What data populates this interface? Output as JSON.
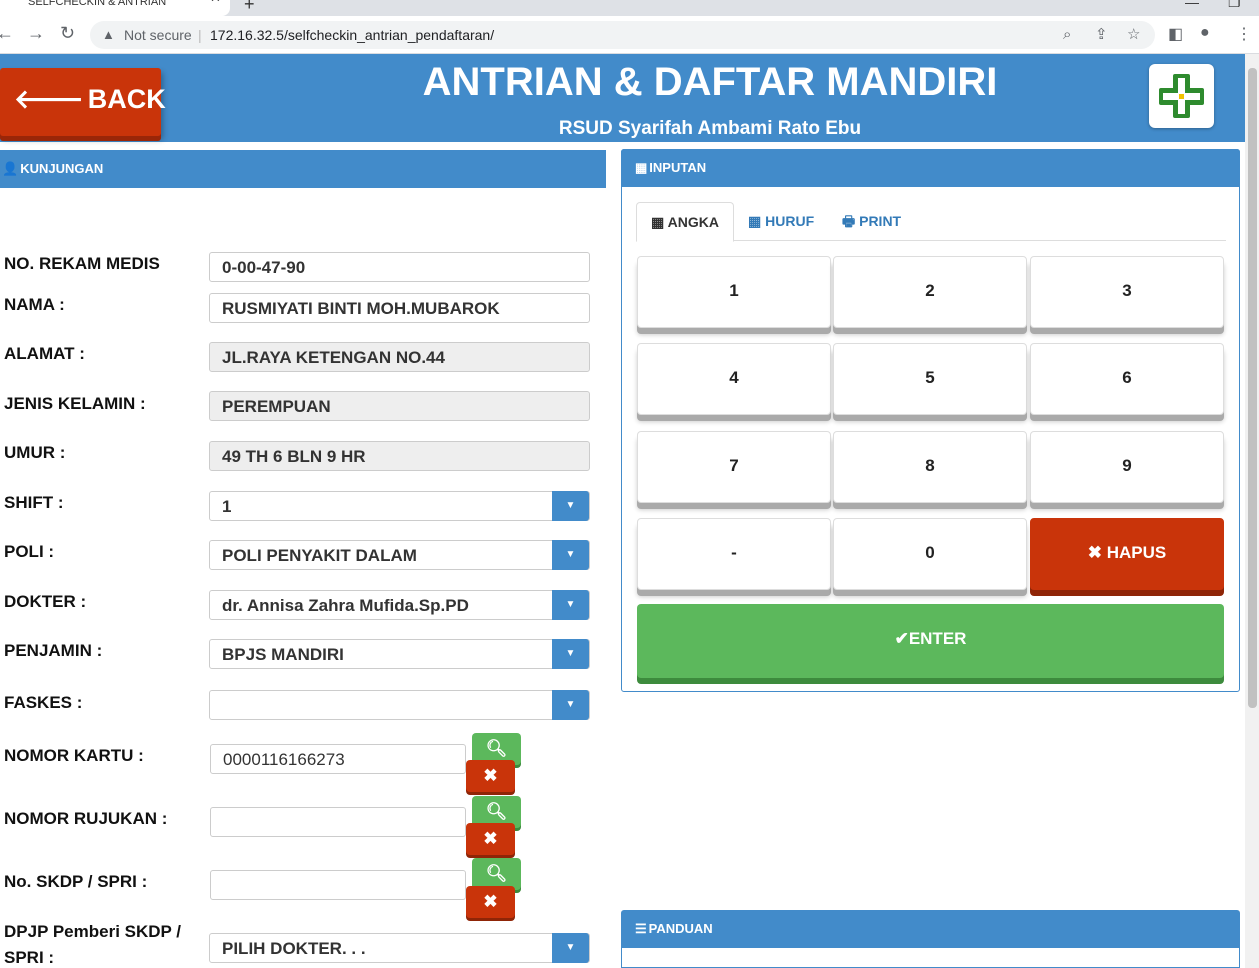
{
  "browser": {
    "tab_title": "SELFCHECKIN & ANTRIAN",
    "not_secure": "Not secure",
    "url": "172.16.32.5/selfcheckin_antrian_pendaftaran/"
  },
  "header": {
    "back_label": "BACK",
    "title": "ANTRIAN & DAFTAR MANDIRI",
    "subtitle": "RSUD Syarifah Ambami Rato Ebu"
  },
  "kunjungan": {
    "heading": "KUNJUNGAN",
    "fields": {
      "no_rm_label": "NO. REKAM MEDIS",
      "no_rm_value": "0-00-47-90",
      "nama_label": "NAMA :",
      "nama_value": "RUSMIYATI BINTI MOH.MUBAROK",
      "alamat_label": "ALAMAT :",
      "alamat_value": "JL.RAYA KETENGAN NO.44",
      "jk_label": "JENIS KELAMIN :",
      "jk_value": "PEREMPUAN",
      "umur_label": "UMUR :",
      "umur_value": "49 TH 6 BLN 9 HR",
      "shift_label": "SHIFT :",
      "shift_value": "1",
      "poli_label": "POLI :",
      "poli_value": "POLI PENYAKIT DALAM",
      "dokter_label": "DOKTER :",
      "dokter_value": "dr. Annisa Zahra Mufida.Sp.PD",
      "penjamin_label": "PENJAMIN :",
      "penjamin_value": "BPJS MANDIRI",
      "faskes_label": "FASKES :",
      "faskes_value": "",
      "kartu_label": "NOMOR KARTU :",
      "kartu_value": "0000116166273",
      "rujukan_label": "NOMOR RUJUKAN :",
      "rujukan_value": "",
      "skdp_label": "No. SKDP / SPRI :",
      "skdp_value": "",
      "dpjp_label_1": "DPJP Pemberi SKDP /",
      "dpjp_label_2": "SPRI :",
      "dpjp_value": "PILIH DOKTER. . ."
    }
  },
  "inputan": {
    "heading": "INPUTAN",
    "tabs": [
      "ANGKA",
      "HURUF",
      "PRINT"
    ],
    "keys": [
      "1",
      "2",
      "3",
      "4",
      "5",
      "6",
      "7",
      "8",
      "9",
      "-",
      "0"
    ],
    "hapus_label": "HAPUS",
    "enter_label": "ENTER"
  },
  "panduan": {
    "heading": "PANDUAN"
  },
  "colors": {
    "primary": "#428bca",
    "danger": "#c9340a",
    "success": "#5cb85c"
  }
}
